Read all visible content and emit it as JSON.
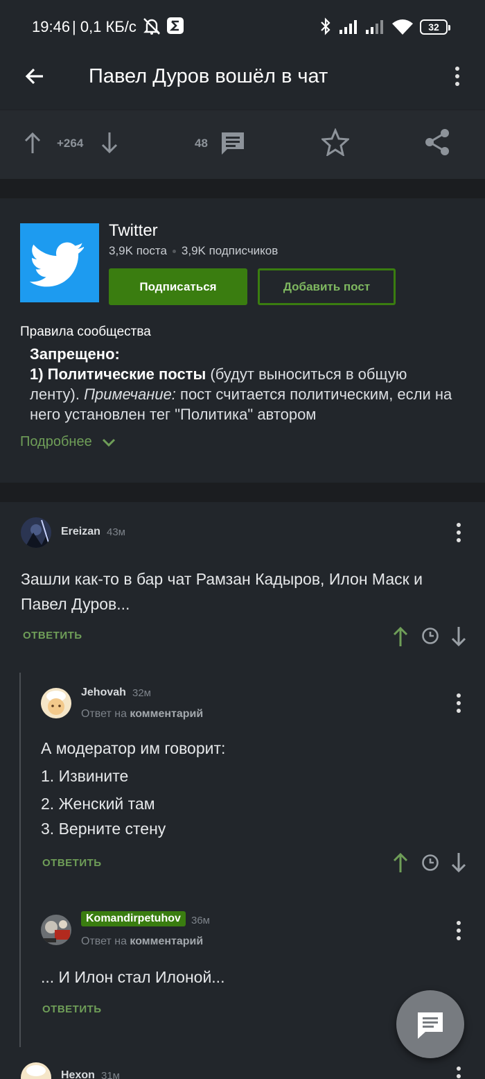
{
  "status_bar": {
    "time": "19:46",
    "speed": "| 0,1 КБ/с",
    "battery": "32"
  },
  "header": {
    "title": "Павел Дуров вошёл в чат"
  },
  "post_actions": {
    "rating": "+264",
    "comments_count": "48"
  },
  "community": {
    "name": "Twitter",
    "posts": "3,9K поста",
    "subscribers": "3,9K подписчиков",
    "subscribe_label": "Подписаться",
    "add_post_label": "Добавить пост",
    "rules_title": "Правила сообщества",
    "rules_forbidden": "Запрещено:",
    "rules_item_bold": "1) Политические посты",
    "rules_item_text": " (будут выноситься в общую ленту). ",
    "rules_note_label": "Примечание:",
    "rules_note_text": " пост считается политическим, если на него установлен тег \"Политика\" автором",
    "more_label": "Подробнее"
  },
  "comments": [
    {
      "user": "Ereizan",
      "ago": "43м",
      "text_line1": "Зашли как-то в бар чат Рамзан Кадыров, Илон Маск и",
      "text_line2": "Павел Дуров...",
      "reply_label": "ОТВЕТИТЬ"
    },
    {
      "user": "Jehovah",
      "ago": "32м",
      "reply_prefix": "Ответ на ",
      "reply_target": "комментарий",
      "lines": [
        "А модератор им говорит:",
        "1. Извините",
        "2. Женский там",
        "3. Верните стену"
      ],
      "reply_label": "ОТВЕТИТЬ"
    },
    {
      "user": "Komandirpetuhov",
      "ago": "36м",
      "reply_prefix": "Ответ на ",
      "reply_target": "комментарий",
      "text": "... И Илон стал Илоной...",
      "reply_label": "ОТВЕТИТЬ"
    },
    {
      "user": "Hexon",
      "ago": "31м"
    }
  ],
  "colors": {
    "accent_green": "#3a7d10",
    "link_green": "#6f9e58",
    "background": "#22262b"
  }
}
